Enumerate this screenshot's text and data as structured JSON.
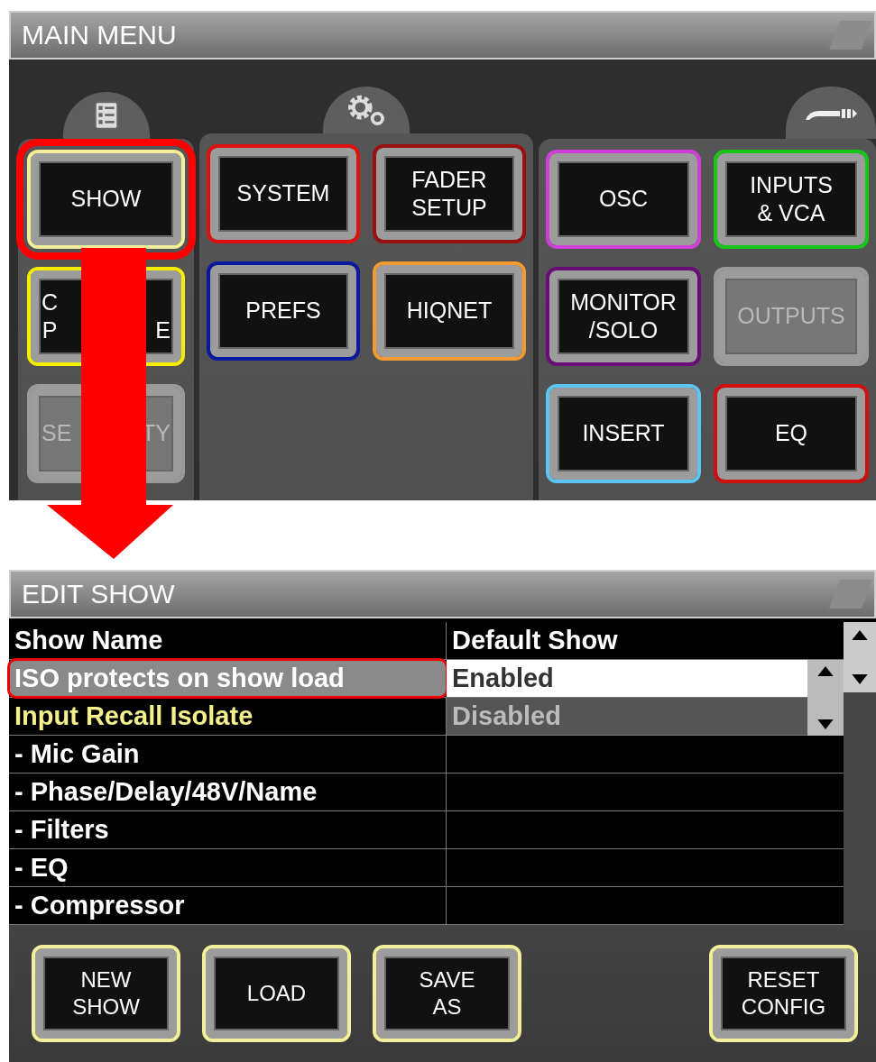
{
  "main_menu": {
    "title": "MAIN MENU",
    "columns": [
      {
        "buttons": [
          {
            "label": [
              "SHOW"
            ],
            "color": "#f2ee9a",
            "disabled": false,
            "highlighted": true
          },
          {
            "label_left": [
              "C",
              "P"
            ],
            "label_right": [
              "E"
            ],
            "color": "#f5ee00",
            "disabled": false,
            "highlighted": false
          },
          {
            "label_left": [
              "SE"
            ],
            "label_right": [
              "TY"
            ],
            "color": "#9a9a9a",
            "disabled": true,
            "highlighted": false
          }
        ]
      },
      {
        "buttons": [
          {
            "label": [
              "SYSTEM"
            ],
            "color": "#e01010",
            "disabled": false,
            "highlighted": false
          },
          {
            "label": [
              "FADER",
              "SETUP"
            ],
            "color": "#9a0f0f",
            "disabled": false,
            "highlighted": false
          },
          {
            "label": [
              "PREFS"
            ],
            "color": "#0a1aa0",
            "disabled": false,
            "highlighted": false
          },
          {
            "label": [
              "HIQNET"
            ],
            "color": "#f39a30",
            "disabled": false,
            "highlighted": false
          }
        ]
      },
      {
        "buttons": [
          {
            "label": [
              "OSC"
            ],
            "color": "#d040d8",
            "disabled": false,
            "highlighted": false
          },
          {
            "label": [
              "INPUTS",
              "& VCA"
            ],
            "color": "#18c818",
            "disabled": false,
            "highlighted": false
          },
          {
            "label": [
              "MONITOR",
              "/SOLO"
            ],
            "color": "#6a0c78",
            "disabled": false,
            "highlighted": false
          },
          {
            "label": [
              "OUTPUTS"
            ],
            "color": "#9a9a9a",
            "disabled": true,
            "highlighted": false
          },
          {
            "label": [
              "INSERT"
            ],
            "color": "#5cc4f0",
            "disabled": false,
            "highlighted": false
          },
          {
            "label": [
              "EQ"
            ],
            "color": "#d01010",
            "disabled": false,
            "highlighted": false
          }
        ]
      }
    ]
  },
  "edit_show": {
    "title": "EDIT SHOW",
    "rows": [
      {
        "label": "Show Name",
        "value": "Default Show",
        "selected": false,
        "focused": false,
        "highlighted": false,
        "kind": "text"
      },
      {
        "label": "ISO protects on show load",
        "value": "Enabled",
        "selected": true,
        "focused": false,
        "highlighted": true,
        "kind": "option"
      },
      {
        "label": "Input Recall Isolate",
        "value": "Disabled",
        "selected": false,
        "focused": true,
        "highlighted": false,
        "kind": "option"
      },
      {
        "label": "- Mic Gain",
        "selected": false,
        "focused": false,
        "highlighted": false,
        "kind": "text"
      },
      {
        "label": "- Phase/Delay/48V/Name",
        "selected": false,
        "focused": false,
        "highlighted": false,
        "kind": "text"
      },
      {
        "label": "- Filters",
        "selected": false,
        "focused": false,
        "highlighted": false,
        "kind": "text"
      },
      {
        "label": "- EQ",
        "selected": false,
        "focused": false,
        "highlighted": false,
        "kind": "text"
      },
      {
        "label": "- Compressor",
        "selected": false,
        "focused": false,
        "highlighted": false,
        "kind": "text"
      }
    ],
    "buttons": [
      {
        "label": [
          "NEW",
          "SHOW"
        ]
      },
      {
        "label": [
          "LOAD"
        ]
      },
      {
        "label": [
          "SAVE",
          "AS"
        ]
      },
      {
        "label": [
          "RESET",
          "CONFIG"
        ]
      }
    ]
  }
}
